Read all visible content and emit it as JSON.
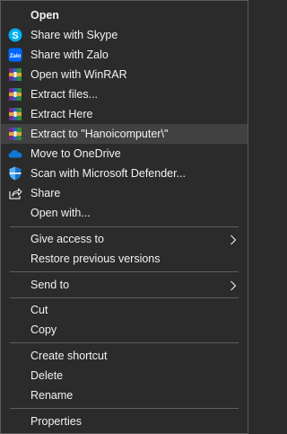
{
  "menu": {
    "items": [
      {
        "label": "Open",
        "icon": "none"
      },
      {
        "label": "Share with Skype",
        "icon": "skype-icon"
      },
      {
        "label": "Share with Zalo",
        "icon": "zalo-icon"
      },
      {
        "label": "Open with WinRAR",
        "icon": "winrar-icon"
      },
      {
        "label": "Extract files...",
        "icon": "winrar-icon"
      },
      {
        "label": "Extract Here",
        "icon": "winrar-icon"
      },
      {
        "label": "Extract to \"Hanoicomputer\\\"",
        "icon": "winrar-icon"
      },
      {
        "label": "Move to OneDrive",
        "icon": "onedrive-icon"
      },
      {
        "label": "Scan with Microsoft Defender...",
        "icon": "defender-icon"
      },
      {
        "label": "Share",
        "icon": "share-icon"
      },
      {
        "label": "Open with...",
        "icon": "none"
      },
      {
        "label": "Give access to",
        "icon": "none",
        "submenu": true
      },
      {
        "label": "Restore previous versions",
        "icon": "none"
      },
      {
        "label": "Send to",
        "icon": "none",
        "submenu": true
      },
      {
        "label": "Cut",
        "icon": "none"
      },
      {
        "label": "Copy",
        "icon": "none"
      },
      {
        "label": "Create shortcut",
        "icon": "none"
      },
      {
        "label": "Delete",
        "icon": "none"
      },
      {
        "label": "Rename",
        "icon": "none"
      },
      {
        "label": "Properties",
        "icon": "none"
      }
    ]
  },
  "colors": {
    "background": "#2b2b2b",
    "text": "#f2f2f2",
    "hover": "#414141",
    "separator": "#5f5f5f",
    "skype": "#00aff0",
    "zalo": "#0068ff",
    "onedrive": "#0f78d4",
    "defender": "#1a74c9"
  }
}
